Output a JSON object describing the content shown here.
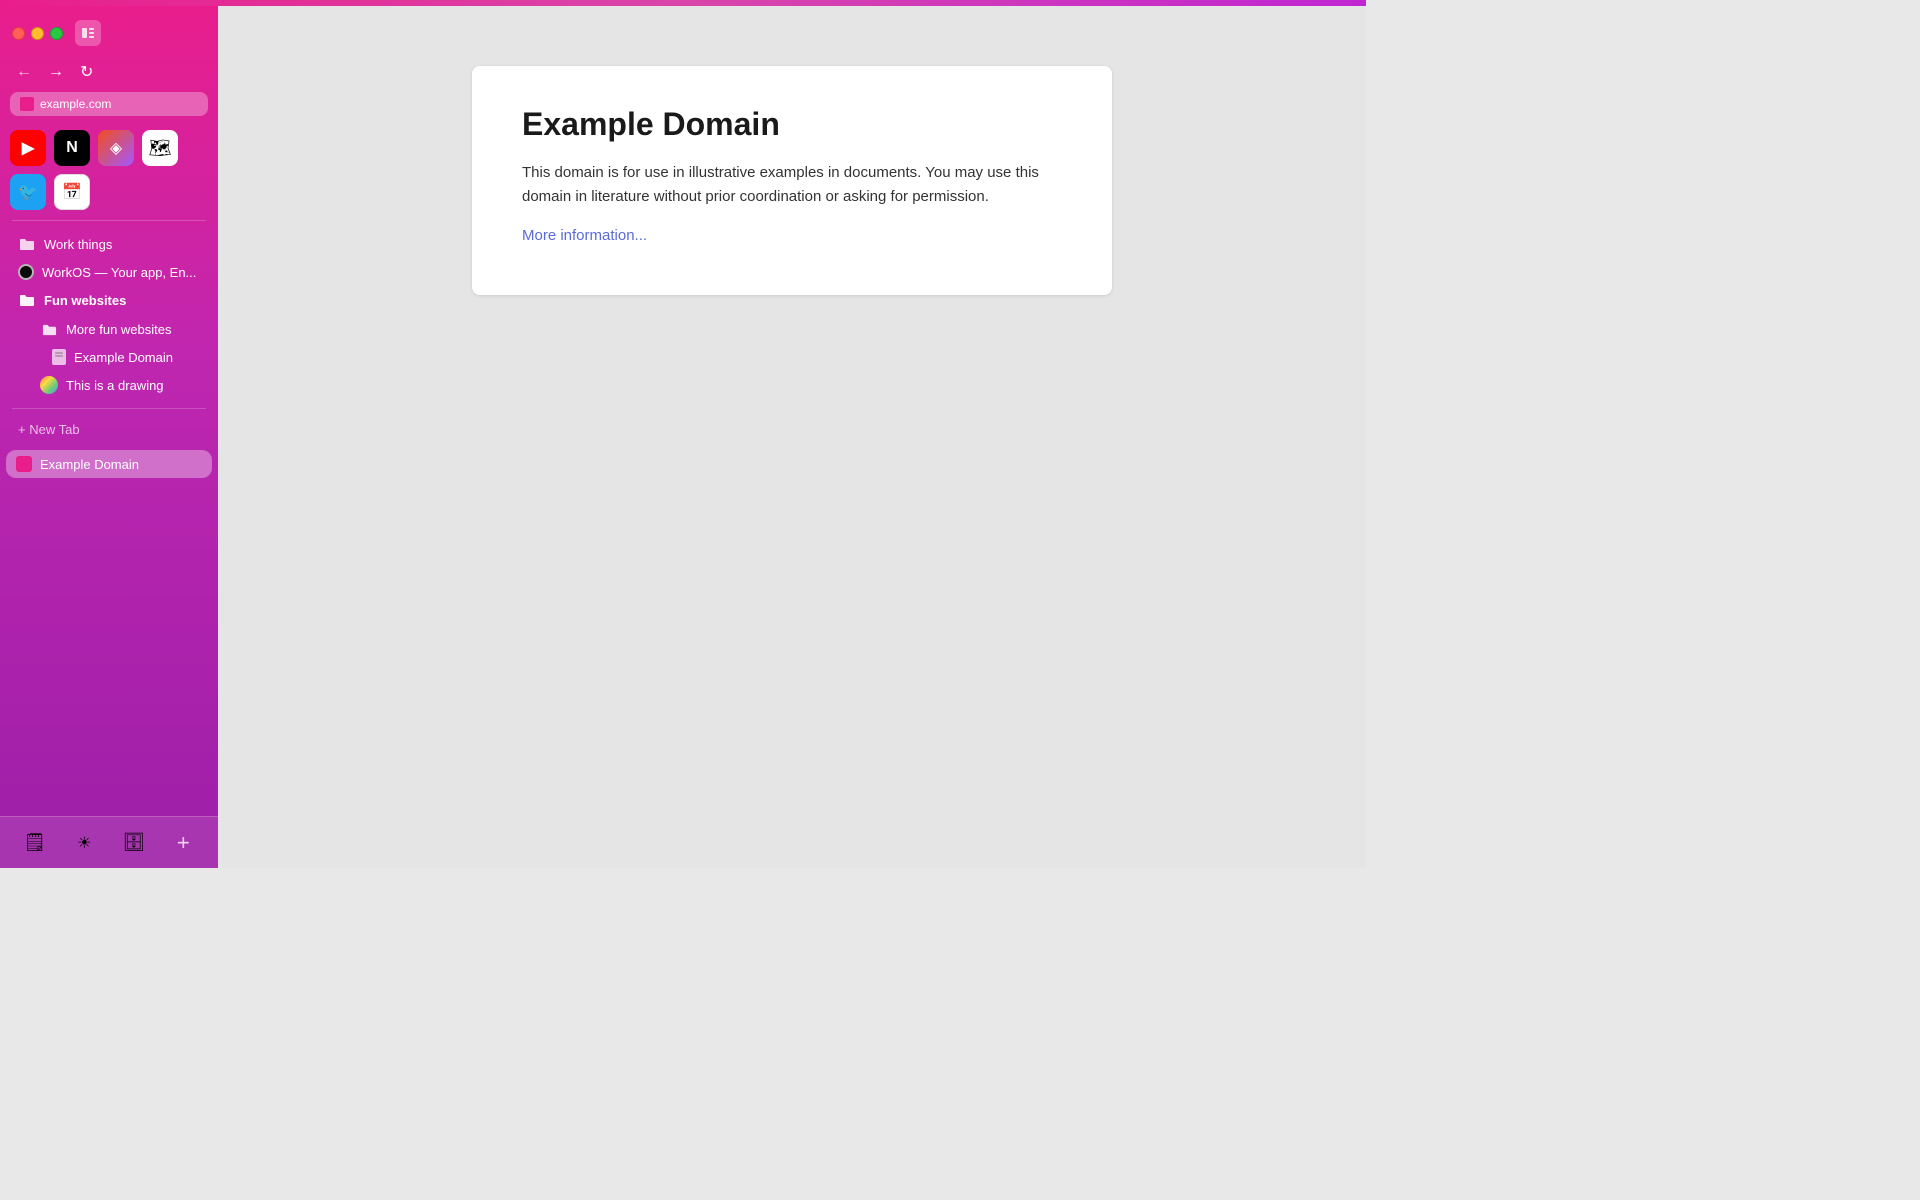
{
  "browser": {
    "top_gradient": "#e91e8c",
    "address_bar": {
      "url": "example.com"
    },
    "nav": {
      "back_label": "←",
      "forward_label": "→",
      "reload_label": "↻"
    }
  },
  "sidebar": {
    "bookmarks": [
      {
        "id": "youtube",
        "label": "YouTube",
        "icon": "▶",
        "color": "#ff0000"
      },
      {
        "id": "notion",
        "label": "Notion",
        "icon": "N",
        "color": "#000"
      },
      {
        "id": "figma",
        "label": "Figma",
        "icon": "◈",
        "color": "#f24e1e"
      },
      {
        "id": "googlemaps",
        "label": "Google Maps",
        "icon": "📍",
        "color": "#fff"
      },
      {
        "id": "twitter",
        "label": "Twitter",
        "icon": "🐦",
        "color": "#1da1f2"
      },
      {
        "id": "gcal",
        "label": "Google Calendar",
        "icon": "📅",
        "color": "#fff"
      }
    ],
    "sections": [
      {
        "id": "work-things",
        "label": "Work things",
        "type": "folder"
      },
      {
        "id": "workos",
        "label": "WorkOS — Your app, En...",
        "type": "tab"
      },
      {
        "id": "fun-websites",
        "label": "Fun websites",
        "type": "folder-bold"
      },
      {
        "id": "more-fun-websites",
        "label": "More fun websites",
        "type": "subfolder"
      },
      {
        "id": "example-domain-sub",
        "label": "Example Domain",
        "type": "page"
      },
      {
        "id": "this-is-a-drawing",
        "label": "This is a drawing",
        "type": "drawing"
      }
    ],
    "new_tab_label": "+ New Tab",
    "active_tab": {
      "label": "Example Domain"
    },
    "dock_icons": [
      "🗒",
      "☀",
      "🗄",
      "+"
    ]
  },
  "main": {
    "content_card": {
      "title": "Example Domain",
      "body": "This domain is for use in illustrative examples in documents. You may use this domain in literature without prior coordination or asking for permission.",
      "link_text": "More information...",
      "link_href": "#"
    }
  }
}
